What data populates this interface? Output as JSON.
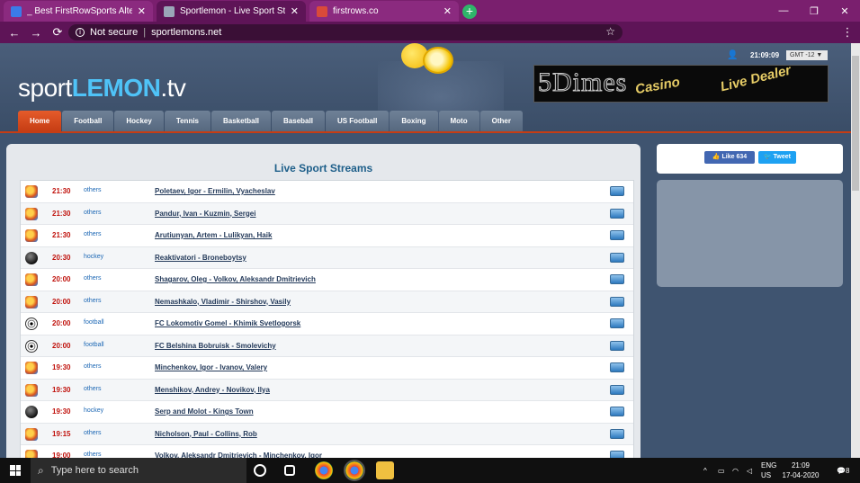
{
  "browser": {
    "tabs": [
      {
        "label": "_ Best FirstRowSports Alternativ",
        "close": "✕",
        "favicon_color": "#3b7be9",
        "active": false
      },
      {
        "label": "Sportlemon - Live Sport Streams",
        "close": "✕",
        "favicon_color": "#9aa6b8",
        "active": true
      },
      {
        "label": "firstrows.co",
        "close": "✕",
        "favicon_color": "#d94a3a",
        "active": false
      }
    ],
    "new_tab": "+",
    "window_controls": {
      "minimize": "—",
      "maximize": "❐",
      "close": "✕"
    },
    "nav": {
      "back": "←",
      "forward": "→",
      "reload": "⟳"
    },
    "security": "Not secure",
    "url": "sportlemons.net",
    "bookmark_icon": "☆",
    "menu_icon": "⋮"
  },
  "site": {
    "logo_light": "sport",
    "logo_strong": "LEMON",
    "logo_tld": ".tv",
    "clock": "21:09:09",
    "timezone": "GMT -12 ▼",
    "banner": {
      "brand": "5Dimes",
      "text1": "Casino",
      "text2": "Live Dealer"
    },
    "menu": [
      "Home",
      "Football",
      "Hockey",
      "Tennis",
      "Basketball",
      "Baseball",
      "US Football",
      "Boxing",
      "Moto",
      "Other"
    ],
    "panel_title": "Live Sport Streams",
    "social": {
      "like": "Like 634",
      "tweet": "Tweet"
    },
    "events": [
      {
        "time": "21:30",
        "sport": "others",
        "match": "Poletaev, Igor - Ermilin, Vyacheslav"
      },
      {
        "time": "21:30",
        "sport": "others",
        "match": "Pandur, Ivan - Kuzmin, Sergei"
      },
      {
        "time": "21:30",
        "sport": "others",
        "match": "Arutiunyan, Artem - Lulikyan, Haik"
      },
      {
        "time": "20:30",
        "sport": "hockey",
        "match": "Reaktivatori - Broneboytsy"
      },
      {
        "time": "20:00",
        "sport": "others",
        "match": "Shagarov, Oleg - Volkov, Aleksandr Dmitrievich"
      },
      {
        "time": "20:00",
        "sport": "others",
        "match": "Nemashkalo, Vladimir - Shirshov, Vasily"
      },
      {
        "time": "20:00",
        "sport": "football",
        "match": "FC Lokomotiv Gomel - Khimik Svetlogorsk"
      },
      {
        "time": "20:00",
        "sport": "football",
        "match": "FC Belshina Bobruisk - Smolevichy"
      },
      {
        "time": "19:30",
        "sport": "others",
        "match": "Minchenkov, Igor - Ivanov, Valery"
      },
      {
        "time": "19:30",
        "sport": "others",
        "match": "Menshikov, Andrey - Novikov, Ilya"
      },
      {
        "time": "19:30",
        "sport": "hockey",
        "match": "Serp and Molot - Kings Town"
      },
      {
        "time": "19:15",
        "sport": "others",
        "match": "Nicholson, Paul - Collins, Rob"
      },
      {
        "time": "19:00",
        "sport": "others",
        "match": "Volkov, Aleksandr Dmitrievich - Minchenkov, Igor"
      }
    ]
  },
  "taskbar": {
    "search_placeholder": "Type here to search",
    "lang_top": "ENG",
    "lang_bottom": "US",
    "time": "21:09",
    "date": "17-04-2020",
    "notification_count": "8"
  }
}
